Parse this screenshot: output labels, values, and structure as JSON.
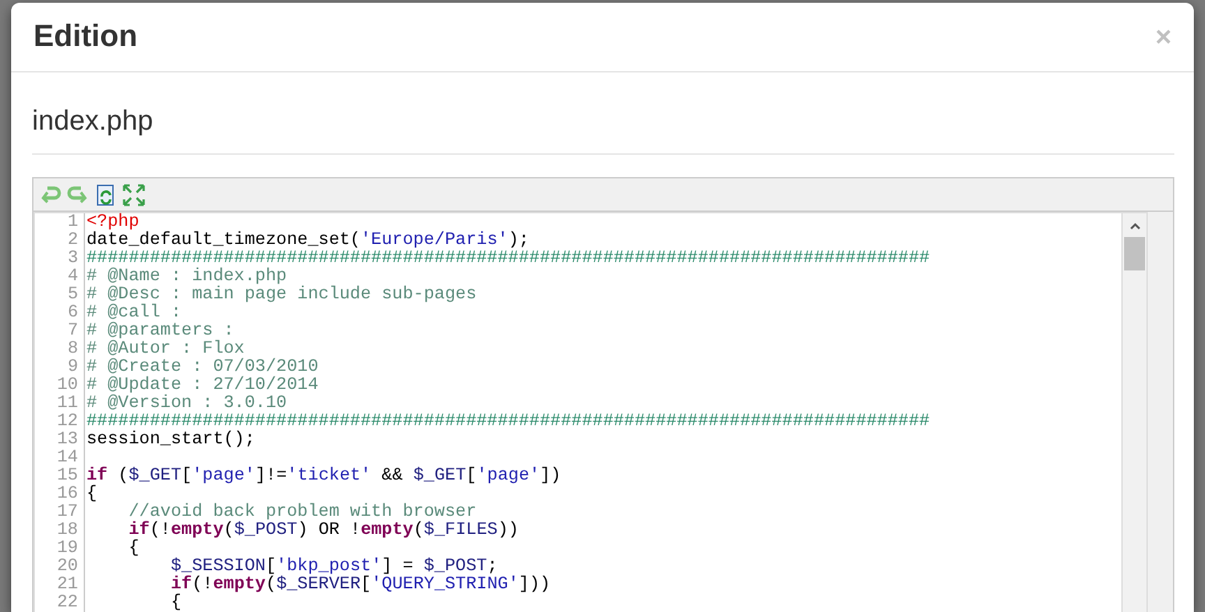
{
  "dialog": {
    "title": "Edition",
    "close": "×"
  },
  "file": {
    "name": "index.php"
  },
  "editor": {
    "lines": [
      {
        "number": "1",
        "tokens": [
          {
            "kind": "tag",
            "text": "<?php"
          }
        ]
      },
      {
        "number": "2",
        "tokens": [
          {
            "kind": "plain",
            "text": "date_default_timezone_set("
          },
          {
            "kind": "string",
            "text": "'Europe/Paris'"
          },
          {
            "kind": "plain",
            "text": ");"
          }
        ]
      },
      {
        "number": "3",
        "tokens": [
          {
            "kind": "hash",
            "text": "################################################################################"
          }
        ]
      },
      {
        "number": "4",
        "tokens": [
          {
            "kind": "comment",
            "text": "# @Name : index.php"
          }
        ]
      },
      {
        "number": "5",
        "tokens": [
          {
            "kind": "comment",
            "text": "# @Desc : main page include sub-pages"
          }
        ]
      },
      {
        "number": "6",
        "tokens": [
          {
            "kind": "comment",
            "text": "# @call :"
          }
        ]
      },
      {
        "number": "7",
        "tokens": [
          {
            "kind": "comment",
            "text": "# @paramters :"
          }
        ]
      },
      {
        "number": "8",
        "tokens": [
          {
            "kind": "comment",
            "text": "# @Autor : Flox"
          }
        ]
      },
      {
        "number": "9",
        "tokens": [
          {
            "kind": "comment",
            "text": "# @Create : 07/03/2010"
          }
        ]
      },
      {
        "number": "10",
        "tokens": [
          {
            "kind": "comment",
            "text": "# @Update : 27/10/2014"
          }
        ]
      },
      {
        "number": "11",
        "tokens": [
          {
            "kind": "comment",
            "text": "# @Version : 3.0.10"
          }
        ]
      },
      {
        "number": "12",
        "tokens": [
          {
            "kind": "hash",
            "text": "################################################################################"
          }
        ]
      },
      {
        "number": "13",
        "tokens": [
          {
            "kind": "plain",
            "text": "session_start();"
          }
        ]
      },
      {
        "number": "14"
      },
      {
        "number": "15",
        "tokens": [
          {
            "kind": "keyword",
            "text": "if"
          },
          {
            "kind": "plain",
            "text": " ("
          },
          {
            "kind": "variable",
            "text": "$_GET"
          },
          {
            "kind": "plain",
            "text": "["
          },
          {
            "kind": "string",
            "text": "'page'"
          },
          {
            "kind": "plain",
            "text": "]!="
          },
          {
            "kind": "string",
            "text": "'ticket'"
          },
          {
            "kind": "plain",
            "text": " && "
          },
          {
            "kind": "variable",
            "text": "$_GET"
          },
          {
            "kind": "plain",
            "text": "["
          },
          {
            "kind": "string",
            "text": "'page'"
          },
          {
            "kind": "plain",
            "text": "])"
          }
        ]
      },
      {
        "number": "16",
        "tokens": [
          {
            "kind": "plain",
            "text": "{"
          }
        ]
      },
      {
        "number": "17",
        "tokens": [
          {
            "kind": "comment",
            "text": "    //avoid back problem with browser"
          }
        ]
      },
      {
        "number": "18",
        "tokens": [
          {
            "kind": "keyword",
            "text": "    if"
          },
          {
            "kind": "plain",
            "text": "(!"
          },
          {
            "kind": "keyword",
            "text": "empty"
          },
          {
            "kind": "plain",
            "text": "("
          },
          {
            "kind": "variable",
            "text": "$_POST"
          },
          {
            "kind": "plain",
            "text": ") OR !"
          },
          {
            "kind": "keyword",
            "text": "empty"
          },
          {
            "kind": "plain",
            "text": "("
          },
          {
            "kind": "variable",
            "text": "$_FILES"
          },
          {
            "kind": "plain",
            "text": "))"
          }
        ]
      },
      {
        "number": "19",
        "tokens": [
          {
            "kind": "plain",
            "text": "    {"
          }
        ]
      },
      {
        "number": "20",
        "tokens": [
          {
            "kind": "variable",
            "text": "        $_SESSION"
          },
          {
            "kind": "plain",
            "text": "["
          },
          {
            "kind": "string",
            "text": "'bkp_post'"
          },
          {
            "kind": "plain",
            "text": "] = "
          },
          {
            "kind": "variable",
            "text": "$_POST"
          },
          {
            "kind": "plain",
            "text": ";"
          }
        ]
      },
      {
        "number": "21",
        "tokens": [
          {
            "kind": "keyword",
            "text": "        if"
          },
          {
            "kind": "plain",
            "text": "(!"
          },
          {
            "kind": "keyword",
            "text": "empty"
          },
          {
            "kind": "plain",
            "text": "("
          },
          {
            "kind": "variable",
            "text": "$_SERVER"
          },
          {
            "kind": "plain",
            "text": "["
          },
          {
            "kind": "string",
            "text": "'QUERY_STRING'"
          },
          {
            "kind": "plain",
            "text": "]))"
          }
        ]
      },
      {
        "number": "22",
        "tokens": [
          {
            "kind": "plain",
            "text": "        {"
          }
        ]
      }
    ]
  }
}
